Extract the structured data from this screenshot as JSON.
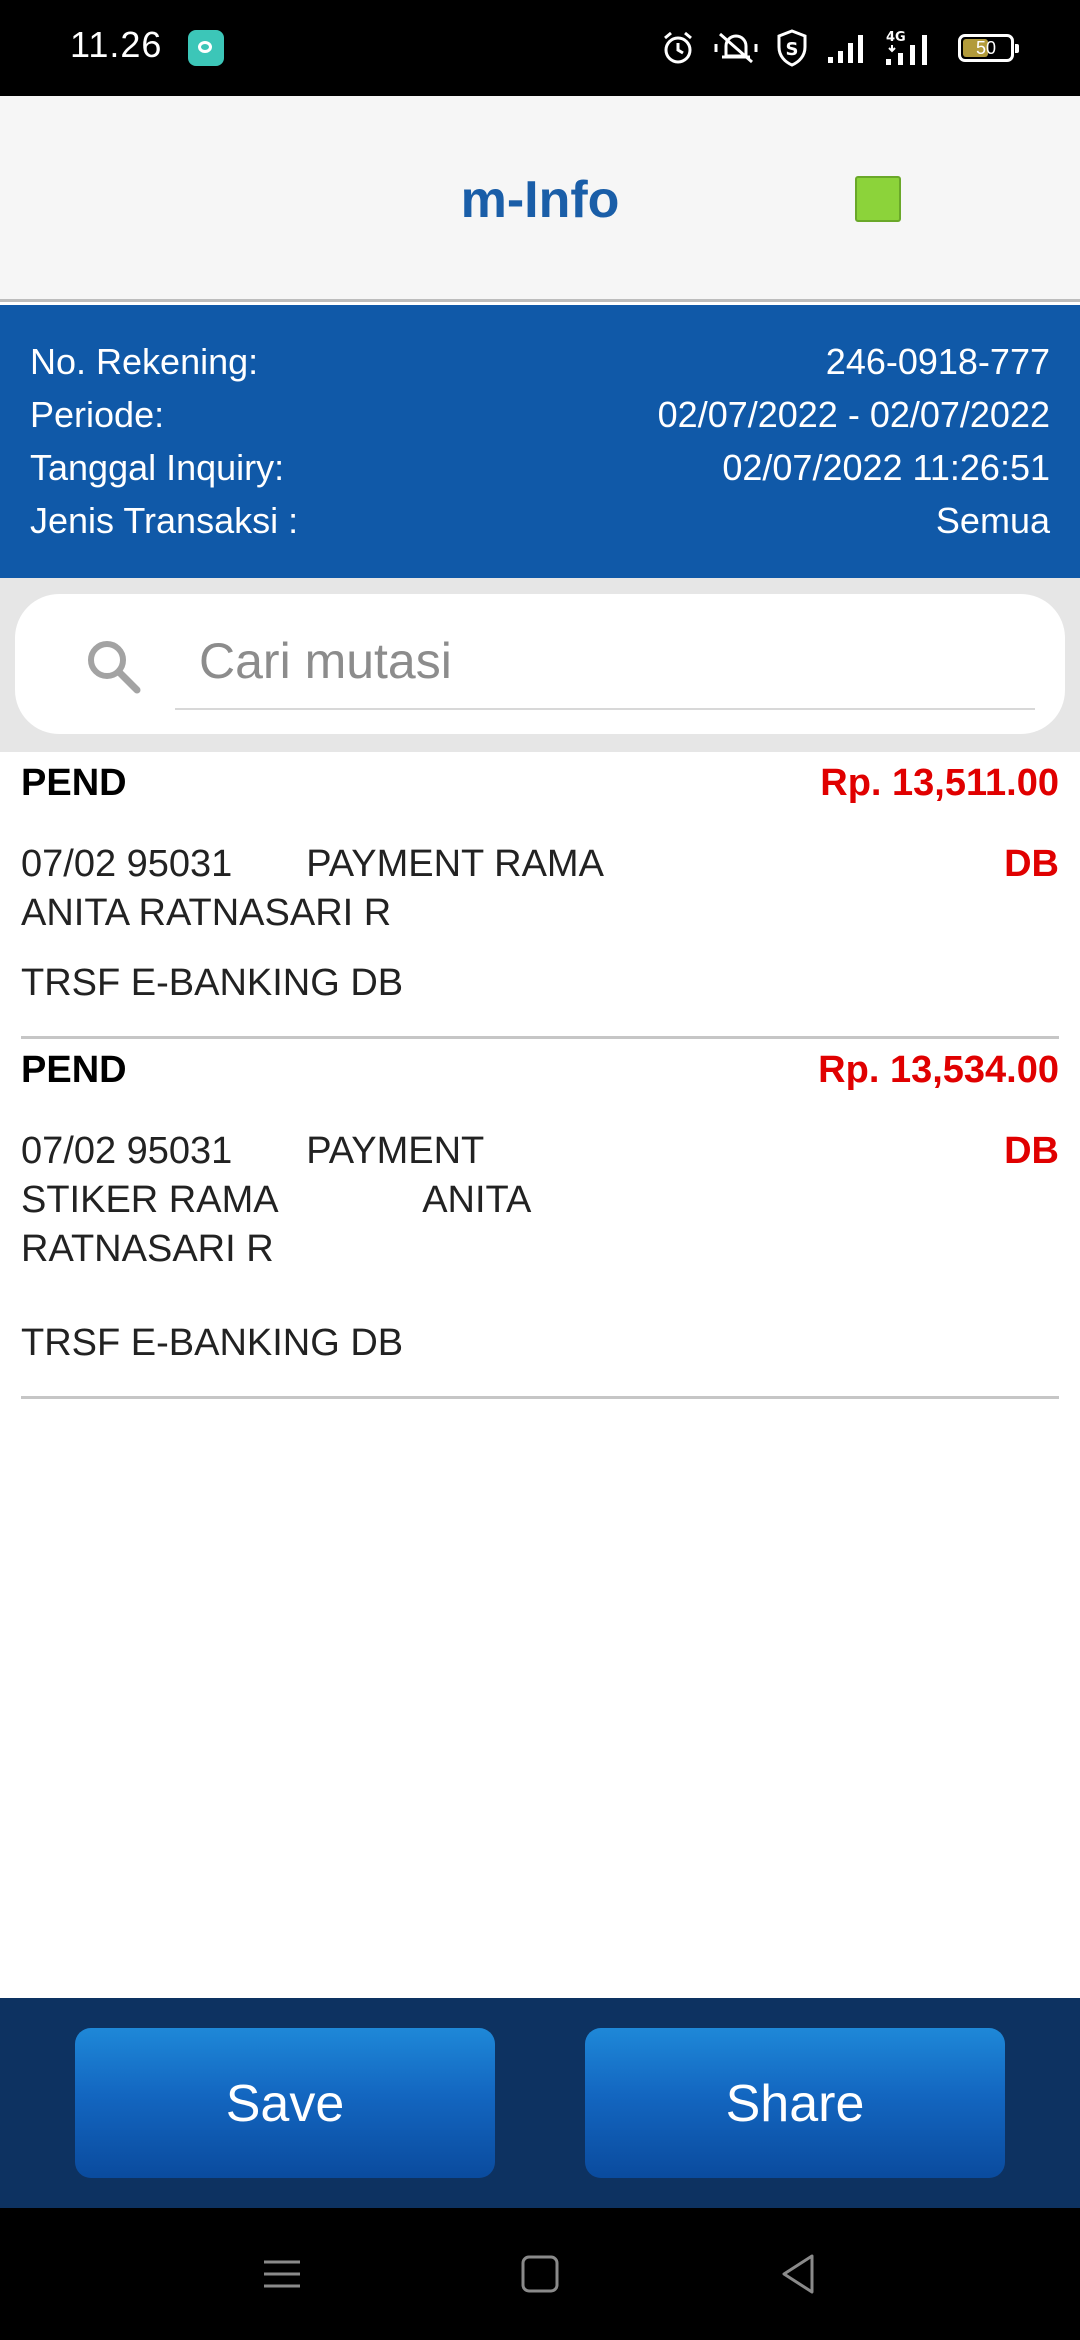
{
  "status_bar": {
    "time": "11.26",
    "network": "4G",
    "battery": "50"
  },
  "header": {
    "title": "m-Info"
  },
  "account_info": {
    "rows": [
      {
        "label": "No. Rekening:",
        "value": "246-0918-777"
      },
      {
        "label": "Periode:",
        "value": "02/07/2022 - 02/07/2022"
      },
      {
        "label": "Tanggal Inquiry:",
        "value": "02/07/2022 11:26:51"
      },
      {
        "label": "Jenis Transaksi :",
        "value": "Semua"
      }
    ]
  },
  "search": {
    "placeholder": "Cari mutasi"
  },
  "transactions": [
    {
      "status": "PEND",
      "amount": "Rp. 13,511.00",
      "type": "DB",
      "description": "07/02 95031       PAYMENT RAMA\nANITA RATNASARI R",
      "channel": "TRSF E-BANKING DB"
    },
    {
      "status": "PEND",
      "amount": "Rp. 13,534.00",
      "type": "DB",
      "description": "07/02 95031       PAYMENT\nSTIKER RAMA              ANITA\nRATNASARI R",
      "channel": "TRSF E-BANKING DB"
    }
  ],
  "actions": {
    "save_label": "Save",
    "share_label": "Share"
  },
  "colors": {
    "header_blue": "#1059a8",
    "title_blue": "#1a5ea8",
    "amount_red": "#e00000",
    "status_green": "#8cd33a",
    "bottom_bar": "#0d3261"
  },
  "icons": [
    "app-notification-icon",
    "alarm-icon",
    "mute-icon",
    "shield-icon",
    "signal-icon",
    "battery-icon",
    "search-icon",
    "menu-icon",
    "home-icon",
    "back-icon"
  ]
}
